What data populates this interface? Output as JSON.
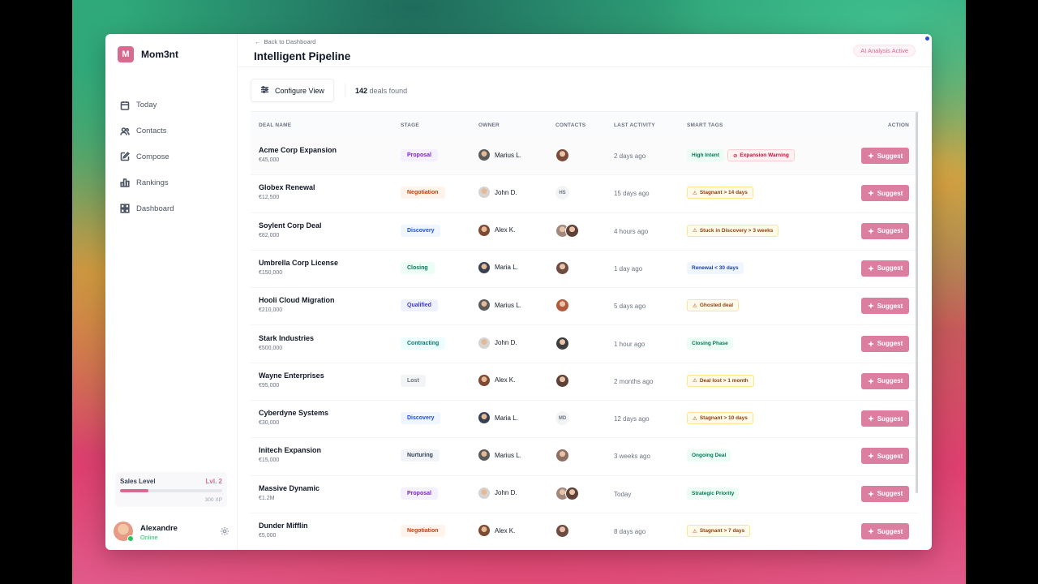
{
  "app": {
    "brand_initial": "M",
    "brand_name": "Mom3nt",
    "accent": "#d76a8e"
  },
  "sidebar": {
    "items": [
      {
        "label": "Today",
        "icon": "calendar-icon"
      },
      {
        "label": "Contacts",
        "icon": "users-icon"
      },
      {
        "label": "Compose",
        "icon": "compose-icon"
      },
      {
        "label": "Rankings",
        "icon": "bar-chart-icon"
      },
      {
        "label": "Dashboard",
        "icon": "grid-icon"
      }
    ],
    "level": {
      "title": "Sales Level",
      "value": "Lvl. 2",
      "xp": "300 XP",
      "progress": 0.28
    },
    "user": {
      "name": "Alexandre",
      "status": "Online"
    }
  },
  "header": {
    "back_label": "Back to Dashboard",
    "title": "Intelligent Pipeline",
    "ai_badge": "AI Analysis Active"
  },
  "toolbar": {
    "configure_label": "Configure View",
    "count": "142",
    "count_suffix": "deals found"
  },
  "table": {
    "columns": [
      "DEAL NAME",
      "STAGE",
      "OWNER",
      "CONTACTS",
      "LAST ACTIVITY",
      "SMART TAGS",
      "ACTION"
    ],
    "action_label": "Suggest",
    "rows": [
      {
        "name": "Acme Corp Expansion",
        "value": "€45,000",
        "stage": "Proposal",
        "stage_color": "purple",
        "owner": "Marius L.",
        "contacts": [
          "photo"
        ],
        "activity": "2 days ago",
        "tags": [
          {
            "text": "High Intent",
            "kind": "green"
          },
          {
            "text": "Expansion Warning",
            "kind": "red"
          }
        ]
      },
      {
        "name": "Globex Renewal",
        "value": "€12,500",
        "stage": "Negotiation",
        "stage_color": "orange",
        "owner": "John D.",
        "contacts": [
          "HS"
        ],
        "activity": "15 days ago",
        "tags": [
          {
            "text": "Stagnant > 14 days",
            "kind": "amber"
          }
        ]
      },
      {
        "name": "Soylent Corp Deal",
        "value": "€82,000",
        "stage": "Discovery",
        "stage_color": "blue",
        "owner": "Alex K.",
        "contacts": [
          "photo",
          "photo"
        ],
        "activity": "4 hours ago",
        "tags": [
          {
            "text": "Stuck in Discovery > 3 weeks",
            "kind": "amber"
          }
        ]
      },
      {
        "name": "Umbrella Corp License",
        "value": "€150,000",
        "stage": "Closing",
        "stage_color": "green",
        "owner": "Maria L.",
        "contacts": [
          "photo"
        ],
        "activity": "1 day ago",
        "tags": [
          {
            "text": "Renewal < 30 days",
            "kind": "blue"
          }
        ]
      },
      {
        "name": "Hooli Cloud Migration",
        "value": "€210,000",
        "stage": "Qualified",
        "stage_color": "indigo",
        "owner": "Marius L.",
        "contacts": [
          "photo"
        ],
        "activity": "5 days ago",
        "tags": [
          {
            "text": "Ghosted deal",
            "kind": "amber"
          }
        ]
      },
      {
        "name": "Stark Industries",
        "value": "€500,000",
        "stage": "Contracting",
        "stage_color": "teal",
        "owner": "John D.",
        "contacts": [
          "photo"
        ],
        "activity": "1 hour ago",
        "tags": [
          {
            "text": "Closing Phase",
            "kind": "green"
          }
        ]
      },
      {
        "name": "Wayne Enterprises",
        "value": "€95,000",
        "stage": "Lost",
        "stage_color": "gray",
        "owner": "Alex K.",
        "contacts": [
          "photo"
        ],
        "activity": "2 months ago",
        "tags": [
          {
            "text": "Deal lost > 1 month",
            "kind": "amber"
          }
        ]
      },
      {
        "name": "Cyberdyne Systems",
        "value": "€30,000",
        "stage": "Discovery",
        "stage_color": "blue",
        "owner": "Maria L.",
        "contacts": [
          "MD"
        ],
        "activity": "12 days ago",
        "tags": [
          {
            "text": "Stagnant > 10 days",
            "kind": "amber"
          }
        ]
      },
      {
        "name": "Initech Expansion",
        "value": "€15,000",
        "stage": "Nurturing",
        "stage_color": "slate",
        "owner": "Marius L.",
        "contacts": [
          "photo"
        ],
        "activity": "3 weeks ago",
        "tags": [
          {
            "text": "Ongoing Deal",
            "kind": "green"
          }
        ]
      },
      {
        "name": "Massive Dynamic",
        "value": "€1.2M",
        "stage": "Proposal",
        "stage_color": "purple",
        "owner": "John D.",
        "contacts": [
          "photo",
          "photo"
        ],
        "activity": "Today",
        "tags": [
          {
            "text": "Strategic Priority",
            "kind": "green"
          }
        ]
      },
      {
        "name": "Dunder Mifflin",
        "value": "€5,000",
        "stage": "Negotiation",
        "stage_color": "orange",
        "owner": "Alex K.",
        "contacts": [
          "photo"
        ],
        "activity": "8 days ago",
        "tags": [
          {
            "text": "Stagnant > 7 days",
            "kind": "amber"
          }
        ]
      }
    ]
  }
}
